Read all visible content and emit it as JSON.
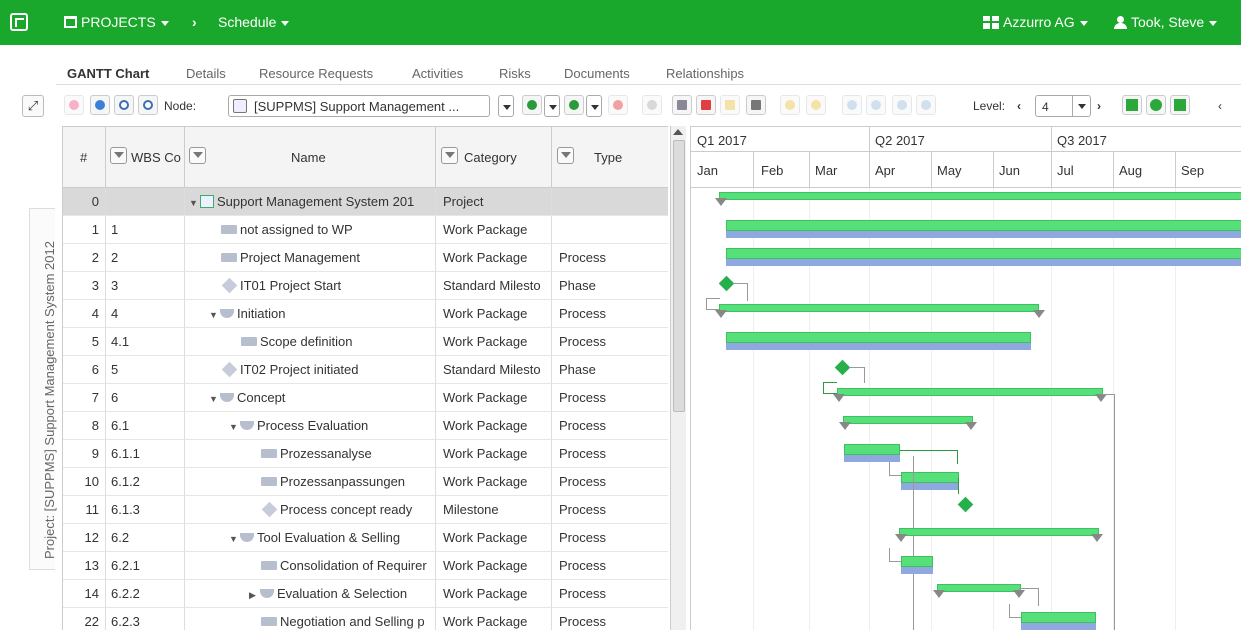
{
  "topbar": {
    "projects_label": "PROJECTS",
    "schedule_label": "Schedule",
    "company_label": "Azzurro AG",
    "user_label": "Took, Steve"
  },
  "tabs": [
    "GANTT Chart",
    "Details",
    "Resource Requests",
    "Activities",
    "Risks",
    "Documents",
    "Relationships"
  ],
  "side_label": "Project: [SUPPMS] Support Management System 2012",
  "toolbar": {
    "node_label": "Node:",
    "node_value": "[SUPPMS] Support Management ...",
    "level_label": "Level:",
    "level_value": "4"
  },
  "columns": {
    "num": "#",
    "wbs": "WBS Co",
    "name": "Name",
    "category": "Category",
    "type": "Type"
  },
  "rows": [
    {
      "num": "0",
      "wbs": "",
      "name": "Support Management System 201",
      "category": "Project",
      "type": ""
    },
    {
      "num": "1",
      "wbs": "1",
      "name": "not assigned to WP",
      "category": "Work Package",
      "type": ""
    },
    {
      "num": "2",
      "wbs": "2",
      "name": "Project Management",
      "category": "Work Package",
      "type": "Process"
    },
    {
      "num": "3",
      "wbs": "3",
      "name": "IT01 Project Start",
      "category": "Standard Milesto",
      "type": "Phase"
    },
    {
      "num": "4",
      "wbs": "4",
      "name": "Initiation",
      "category": "Work Package",
      "type": "Process"
    },
    {
      "num": "5",
      "wbs": "4.1",
      "name": "Scope definition",
      "category": "Work Package",
      "type": "Process"
    },
    {
      "num": "6",
      "wbs": "5",
      "name": "IT02 Project initiated",
      "category": "Standard Milesto",
      "type": "Phase"
    },
    {
      "num": "7",
      "wbs": "6",
      "name": "Concept",
      "category": "Work Package",
      "type": "Process"
    },
    {
      "num": "8",
      "wbs": "6.1",
      "name": "Process Evaluation",
      "category": "Work Package",
      "type": "Process"
    },
    {
      "num": "9",
      "wbs": "6.1.1",
      "name": "Prozessanalyse",
      "category": "Work Package",
      "type": "Process"
    },
    {
      "num": "10",
      "wbs": "6.1.2",
      "name": "Prozessanpassungen",
      "category": "Work Package",
      "type": "Process"
    },
    {
      "num": "11",
      "wbs": "6.1.3",
      "name": "Process concept ready",
      "category": "Milestone",
      "type": "Process"
    },
    {
      "num": "12",
      "wbs": "6.2",
      "name": "Tool Evaluation & Selling",
      "category": "Work Package",
      "type": "Process"
    },
    {
      "num": "13",
      "wbs": "6.2.1",
      "name": "Consolidation of Requirer",
      "category": "Work Package",
      "type": "Process"
    },
    {
      "num": "14",
      "wbs": "6.2.2",
      "name": "Evaluation & Selection",
      "category": "Work Package",
      "type": "Process"
    },
    {
      "num": "22",
      "wbs": "6.2.3",
      "name": "Negotiation and Selling p",
      "category": "Work Package",
      "type": "Process"
    }
  ],
  "gantt": {
    "quarters": [
      "Q1 2017",
      "Q2 2017",
      "Q3 2017"
    ],
    "months": [
      "Jan",
      "Feb",
      "Mar",
      "Apr",
      "May",
      "Jun",
      "Jul",
      "Aug",
      "Sep"
    ]
  },
  "colors": {
    "topbar": "#1aa82c",
    "bar_green": "#57e07a",
    "bar_blue": "#8fa8e0",
    "milestone": "#26b04c"
  }
}
